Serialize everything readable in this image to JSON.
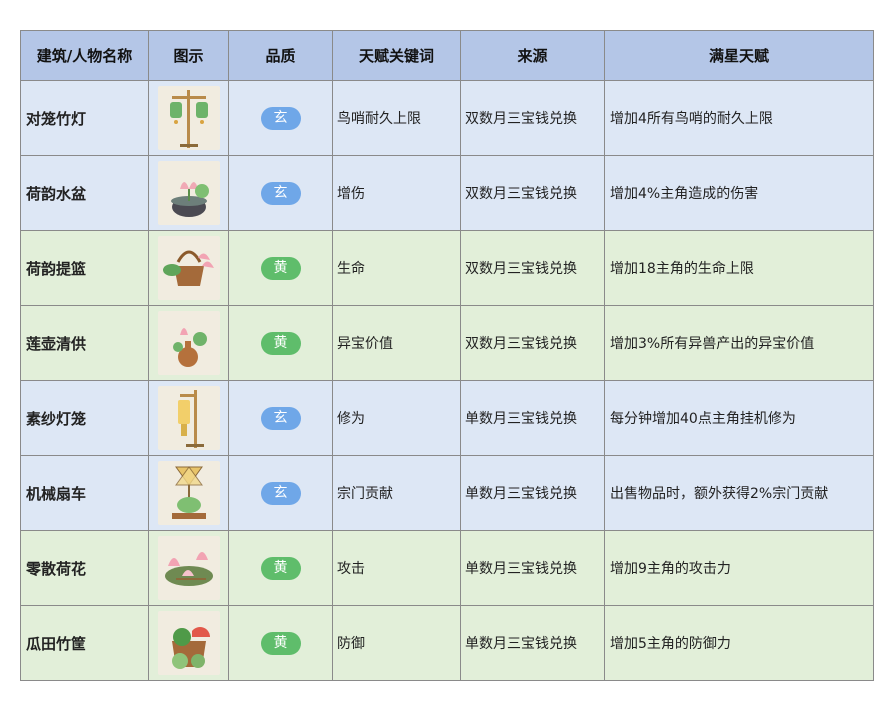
{
  "headers": [
    "建筑/人物名称",
    "图示",
    "品质",
    "天赋关键词",
    "来源",
    "满星天赋"
  ],
  "rows": [
    {
      "name": "对笼竹灯",
      "icon": "bamboo-lantern-icon",
      "quality": "玄",
      "keyword": "鸟哨耐久上限",
      "source": "双数月三宝钱兑换",
      "star": "增加4所有鸟哨的耐久上限",
      "row_color": "#dde7f5"
    },
    {
      "name": "荷韵水盆",
      "icon": "lotus-basin-icon",
      "quality": "玄",
      "keyword": "增伤",
      "source": "双数月三宝钱兑换",
      "star": "增加4%主角造成的伤害",
      "row_color": "#dde7f5"
    },
    {
      "name": "荷韵提篮",
      "icon": "lotus-basket-icon",
      "quality": "黄",
      "keyword": "生命",
      "source": "双数月三宝钱兑换",
      "star": "增加18主角的生命上限",
      "row_color": "#e2efd9"
    },
    {
      "name": "莲壶清供",
      "icon": "lotus-vase-icon",
      "quality": "黄",
      "keyword": "异宝价值",
      "source": "双数月三宝钱兑换",
      "star": "增加3%所有异兽产出的异宝价值",
      "row_color": "#e2efd9"
    },
    {
      "name": "素纱灯笼",
      "icon": "gauze-lantern-icon",
      "quality": "玄",
      "keyword": "修为",
      "source": "单数月三宝钱兑换",
      "star": "每分钟增加40点主角挂机修为",
      "row_color": "#dde7f5"
    },
    {
      "name": "机械扇车",
      "icon": "winnowing-fan-icon",
      "quality": "玄",
      "keyword": "宗门贡献",
      "source": "单数月三宝钱兑换",
      "star": "出售物品时，额外获得2%宗门贡献",
      "row_color": "#dde7f5"
    },
    {
      "name": "零散荷花",
      "icon": "scattered-lotus-icon",
      "quality": "黄",
      "keyword": "攻击",
      "source": "单数月三宝钱兑换",
      "star": "增加9主角的攻击力",
      "row_color": "#e2efd9"
    },
    {
      "name": "瓜田竹筐",
      "icon": "melon-basket-icon",
      "quality": "黄",
      "keyword": "防御",
      "source": "单数月三宝钱兑换",
      "star": "增加5主角的防御力",
      "row_color": "#e2efd9"
    }
  ],
  "colors": {
    "header_bg": "#b4c6e7",
    "xuan_badge": "#6fa7e8",
    "huang_badge": "#5fbd6b"
  }
}
